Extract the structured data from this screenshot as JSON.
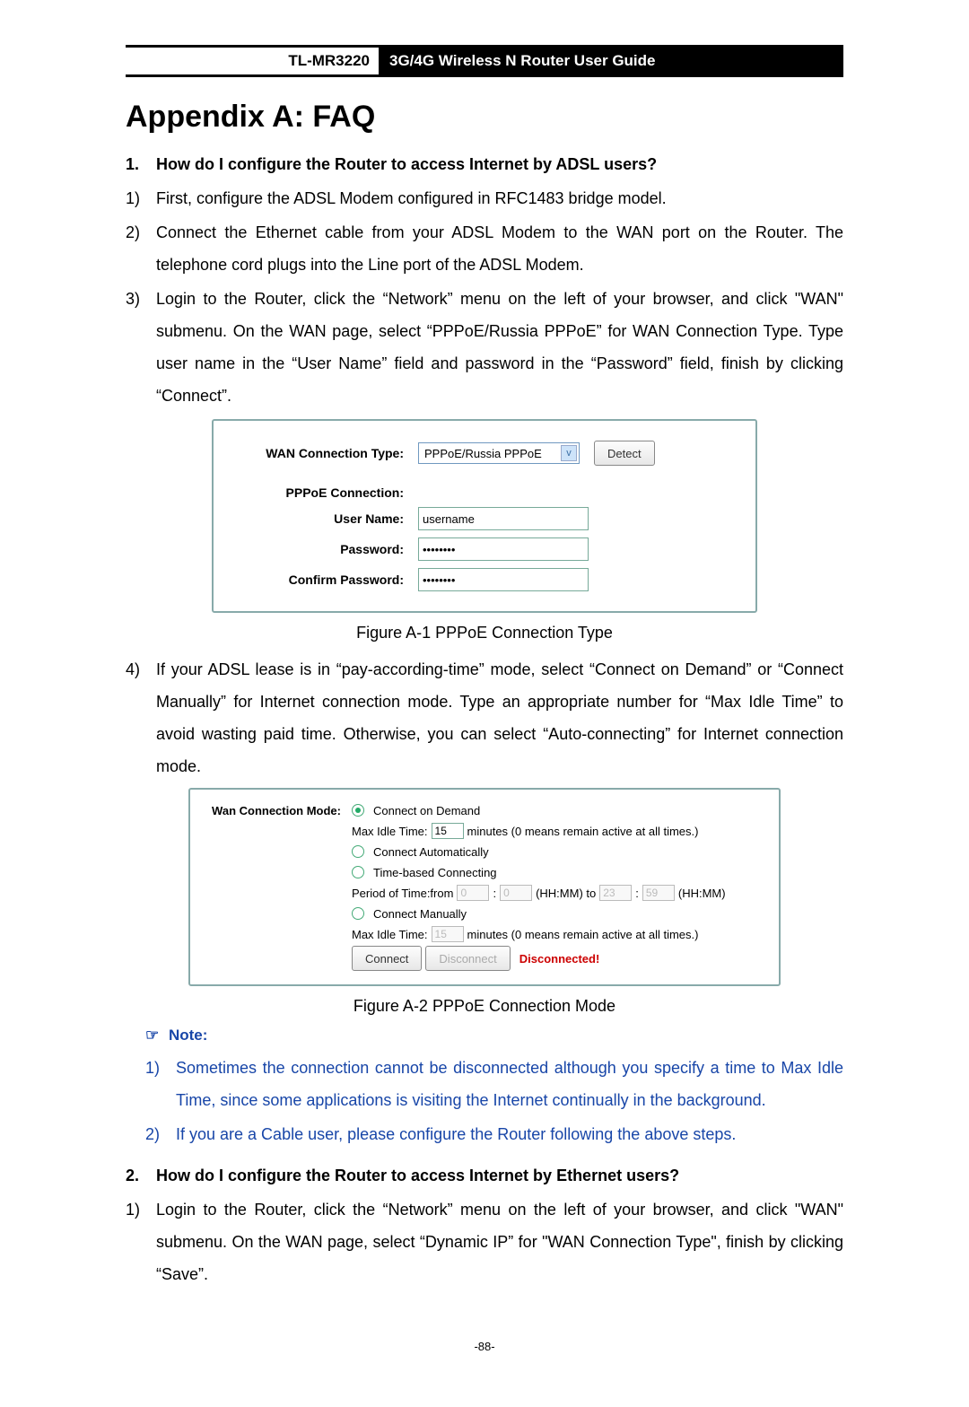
{
  "header": {
    "model": "TL-MR3220",
    "title": "3G/4G Wireless N Router User Guide"
  },
  "page_title": "Appendix A: FAQ",
  "q1": {
    "num": "1.",
    "text": "How do I configure the Router to access Internet by ADSL users?"
  },
  "q1_steps": [
    {
      "num": "1)",
      "text": "First, configure the ADSL Modem configured in RFC1483 bridge model."
    },
    {
      "num": "2)",
      "text": "Connect the Ethernet cable from your ADSL Modem to the WAN port on the Router. The telephone cord plugs into the Line port of the ADSL Modem."
    },
    {
      "num": "3)",
      "text": "Login to the Router, click the “Network” menu on the left of your browser, and click \"WAN\" submenu. On the WAN page, select “PPPoE/Russia PPPoE” for WAN Connection Type. Type user name in the “User Name” field and password in the “Password” field, finish by clicking “Connect”."
    }
  ],
  "figA1": {
    "caption": "Figure A-1 PPPoE Connection Type",
    "wan_type_label": "WAN Connection Type:",
    "wan_type_value": "PPPoE/Russia PPPoE",
    "detect_btn": "Detect",
    "pppoe_section": "PPPoE Connection:",
    "user_label": "User Name:",
    "user_value": "username",
    "pass_label": "Password:",
    "pass_value": "••••••••",
    "confirm_label": "Confirm Password:",
    "confirm_value": "••••••••"
  },
  "q1_step4": {
    "num": "4)",
    "text": "If your ADSL lease is in “pay-according-time” mode, select “Connect on Demand” or “Connect Manually” for Internet connection mode. Type an appropriate number for “Max Idle Time” to avoid wasting paid time. Otherwise, you can select “Auto-connecting” for Internet connection mode."
  },
  "figA2": {
    "caption": "Figure A-2    PPPoE Connection Mode",
    "mode_label": "Wan Connection Mode:",
    "opt_demand": "Connect on Demand",
    "max_idle_label": "Max Idle Time:",
    "max_idle_val1": "15",
    "max_idle_suffix": "minutes (0 means remain active at all times.)",
    "opt_auto": "Connect Automatically",
    "opt_time": "Time-based Connecting",
    "period_label": "Period of Time:from",
    "period_h1": "0",
    "colon": ":",
    "period_m1": "0",
    "hhmm_to": "(HH:MM) to",
    "period_h2": "23",
    "period_m2": "59",
    "hhmm": "(HH:MM)",
    "opt_manual": "Connect Manually",
    "max_idle_val2": "15",
    "connect_btn": "Connect",
    "disconnect_btn": "Disconnect",
    "status": "Disconnected!"
  },
  "note": {
    "head": "Note:",
    "items": [
      {
        "num": "1)",
        "text": "Sometimes the connection cannot be disconnected although you specify a time to Max Idle Time, since some applications is visiting the Internet continually in the background."
      },
      {
        "num": "2)",
        "text": "If you are a Cable user, please configure the Router following the above steps."
      }
    ]
  },
  "q2": {
    "num": "2.",
    "text": "How do I configure the Router to access Internet by Ethernet users?"
  },
  "q2_steps": [
    {
      "num": "1)",
      "text": "Login to the Router, click the “Network” menu on the left of your browser, and click \"WAN\" submenu. On the WAN page, select “Dynamic IP” for \"WAN Connection Type\", finish by clicking “Save”."
    }
  ],
  "footer": "-88-"
}
